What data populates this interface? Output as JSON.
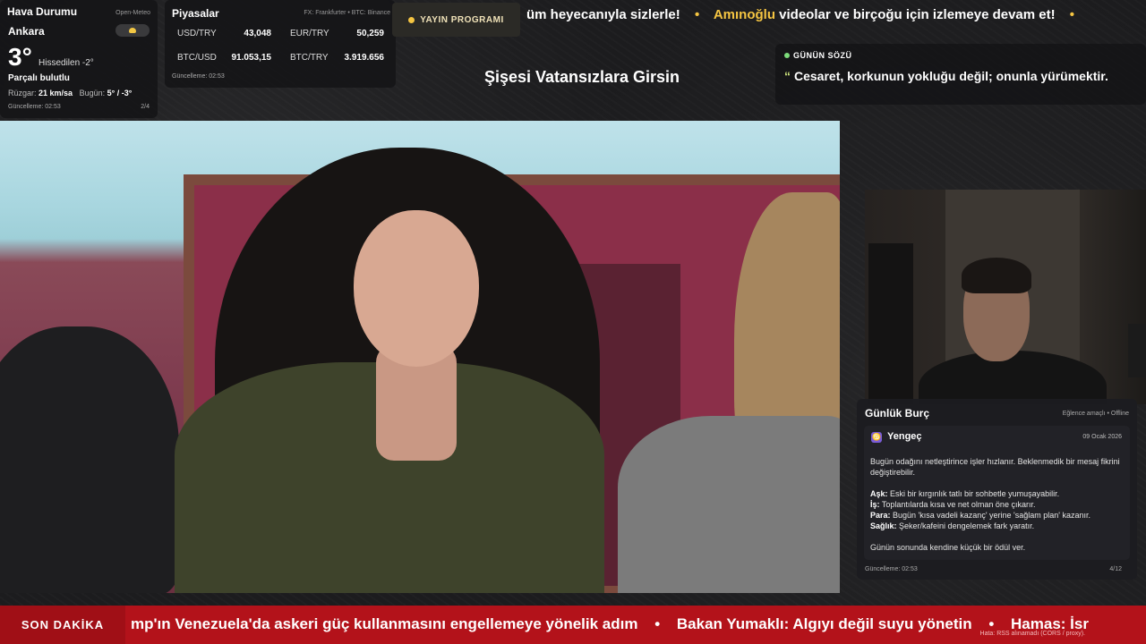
{
  "weather": {
    "title": "Hava Durumu",
    "source": "Open-Meteo",
    "city": "Ankara",
    "temperature": "3°",
    "feels_like": "Hissedilen -2°",
    "condition": "Parçalı bulutlu",
    "wind_label": "Rüzgar:",
    "wind_value": "21 km/sa",
    "today_label": "Bugün:",
    "today_value": "5° / -3°",
    "updated": "Güncelleme: 02:53",
    "page": "2/4",
    "icon": "partly-cloudy-icon"
  },
  "markets": {
    "title": "Piyasalar",
    "source": "FX: Frankfurter • BTC: Binance",
    "rates": [
      {
        "label": "USD/TRY",
        "value": "43,048"
      },
      {
        "label": "EUR/TRY",
        "value": "50,259"
      },
      {
        "label": "BTC/USD",
        "value": "91.053,15"
      },
      {
        "label": "BTC/TRY",
        "value": "3.919.656"
      }
    ],
    "updated": "Güncelleme: 02:53"
  },
  "schedule": {
    "label": "YAYIN PROGRAMI"
  },
  "top_ticker": {
    "part1": "üm heyecanıyla sizlerle!",
    "sep": "•",
    "highlight": "Amınoğlu",
    "part2": "videolar ve birçoğu için izlemeye devam et!",
    "sep2": "•"
  },
  "stream_title": "Şişesi Vatansızlara Girsin",
  "quote": {
    "title": "GÜNÜN SÖZÜ",
    "mark": "“",
    "text": "Cesaret, korkunun yokluğu değil; onunla yürümektir. "
  },
  "horoscope": {
    "title": "Günlük Burç",
    "meta": "Eğlence amaçlı • Offline",
    "sign": "Yengeç",
    "sign_icon": "crab-icon",
    "date": "09 Ocak 2026",
    "intro": "Bugün odağını netleştirince işler hızlanır. Beklenmedik bir mesaj fikrini değiştirebilir.",
    "love_label": "Aşk:",
    "love": "Eski bir kırgınlık tatlı bir sohbetle yumuşayabilir.",
    "work_label": "İş:",
    "work": "Toplantılarda kısa ve net olman öne çıkarır.",
    "money_label": "Para:",
    "money": "Bugün 'kısa vadeli kazanç' yerine 'sağlam plan' kazanır.",
    "health_label": "Sağlık:",
    "health": "Şeker/kafeini dengelemek fark yaratır.",
    "closing": "Günün sonunda kendine küçük bir ödül ver.",
    "updated": "Güncelleme: 02:53",
    "page": "4/12"
  },
  "breaking": {
    "label": "SON DAKİKA",
    "item1": "mp'ın Venezuela'da askeri güç kullanmasını engellemeye yönelik adım",
    "sep": "•",
    "item2": "Bakan Yumaklı: Algıyı değil suyu yönetin",
    "item3": "Hamas: İsr",
    "error": "Hata: RSS alınamadı (CORS / proxy)."
  },
  "colors": {
    "accent_yellow": "#f5c542",
    "breaking_red": "#b3121a",
    "quote_green": "#7ddc7b",
    "sign_purple": "#7a5cd6"
  }
}
